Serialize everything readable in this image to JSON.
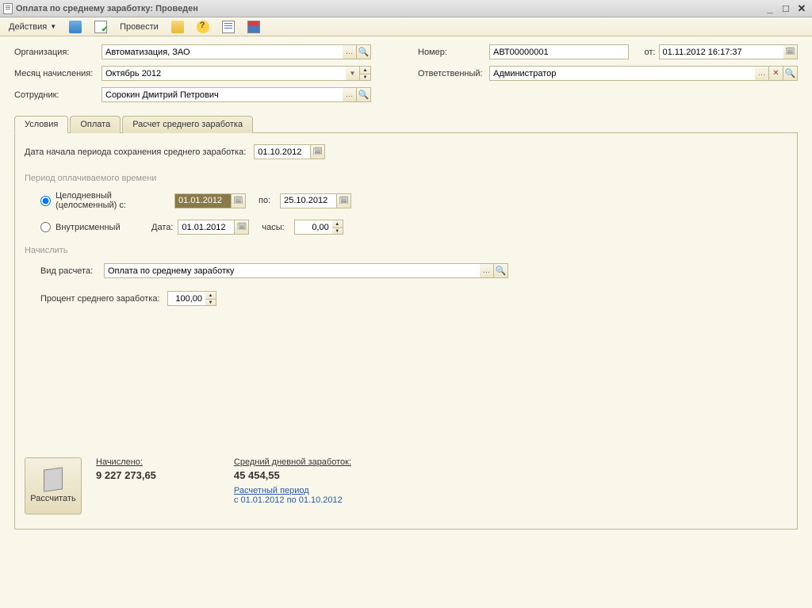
{
  "window": {
    "title": "Оплата по среднему заработку: Проведен"
  },
  "toolbar": {
    "actions": "Действия",
    "post": "Провести"
  },
  "header": {
    "org_label": "Организация:",
    "org_value": "Автоматизация, ЗАО",
    "month_label": "Месяц начисления:",
    "month_value": "Октябрь 2012",
    "emp_label": "Сотрудник:",
    "emp_value": "Сорокин Дмитрий Петрович",
    "num_label": "Номер:",
    "num_value": "АВТ00000001",
    "from_label": "от:",
    "from_value": "01.11.2012 16:17:37",
    "resp_label": "Ответственный:",
    "resp_value": "Администратор"
  },
  "tabs": {
    "t1": "Условия",
    "t2": "Оплата",
    "t3": "Расчет среднего заработка"
  },
  "cond": {
    "start_label": "Дата начала периода сохранения среднего заработка:",
    "start_value": "01.10.2012",
    "period_title": "Период оплачиваемого времени",
    "r1_label": "Целодневный (целосменный) с:",
    "r1_from": "01.01.2012",
    "r1_to_label": "по:",
    "r1_to": "25.10.2012",
    "r2_label": "Внутрисменный",
    "r2_date_label": "Дата:",
    "r2_date": "01.01.2012",
    "r2_hours_label": "часы:",
    "r2_hours": "0,00",
    "accrue_title": "Начислить",
    "calc_type_label": "Вид расчета:",
    "calc_type_value": "Оплата по среднему заработку",
    "percent_label": "Процент среднего заработка:",
    "percent_value": "100,00"
  },
  "summary": {
    "btn": "Рассчитать",
    "accrued_label": "Начислено:",
    "accrued_value": "9 227 273,65",
    "avg_label": "Средний дневной заработок:",
    "avg_value": "45 454,55",
    "period_link": "Расчетный период",
    "period_value": " с 01.01.2012 по 01.10.2012"
  }
}
